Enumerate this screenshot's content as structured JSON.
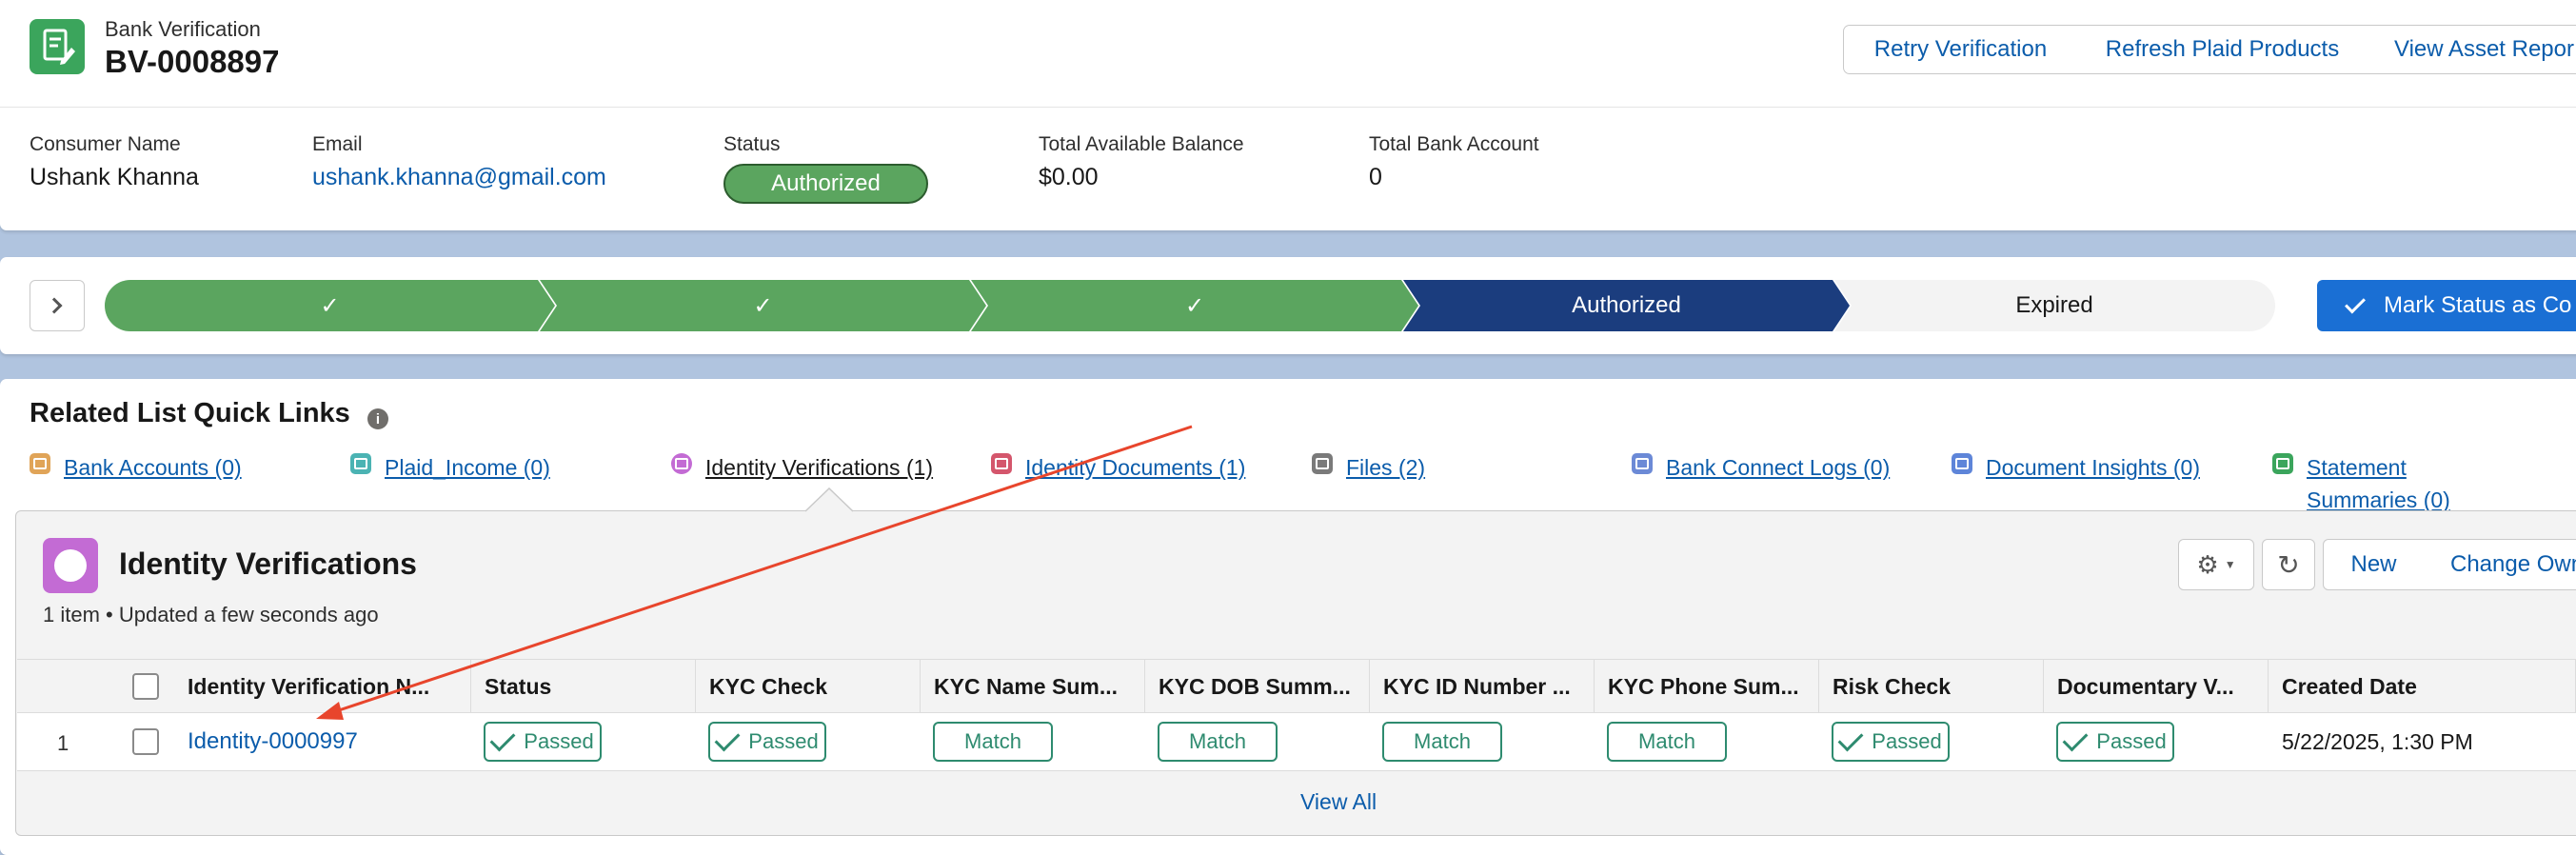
{
  "header": {
    "object_label": "Bank Verification",
    "record_name": "BV-0008897",
    "actions": [
      "Retry Verification",
      "Refresh Plaid Products",
      "View Asset Repor"
    ]
  },
  "highlights": [
    {
      "label": "Consumer Name",
      "value": "Ushank Khanna"
    },
    {
      "label": "Email",
      "value": "ushank.khanna@gmail.com"
    },
    {
      "label": "Status",
      "value": "Authorized"
    },
    {
      "label": "Total Available Balance",
      "value": "$0.00"
    },
    {
      "label": "Total Bank Account",
      "value": "0"
    }
  ],
  "path": {
    "stages": [
      "✓",
      "✓",
      "✓",
      "Authorized",
      "Expired"
    ],
    "mark_button": "Mark Status as Co"
  },
  "quick_links": {
    "title": "Related List Quick Links",
    "links": [
      {
        "label": "Bank Accounts (0)",
        "color": "#e0a458"
      },
      {
        "label": "Plaid_Income (0)",
        "color": "#4bb3b3"
      },
      {
        "label": "Identity Verifications (1)",
        "color": "#c36bd4"
      },
      {
        "label": "Identity Documents (1)",
        "color": "#d4566c"
      },
      {
        "label": "Files (2)",
        "color": "#7a7a7a"
      },
      {
        "label": "Bank Connect Logs (0)",
        "color": "#6c8ad6"
      },
      {
        "label": "Document Insights (0)",
        "color": "#5e85d9"
      },
      {
        "label": "Statement Summaries (0)",
        "color": "#3ba55c"
      }
    ]
  },
  "related_list": {
    "title": "Identity Verifications",
    "meta": "1 item • Updated a few seconds ago",
    "buttons": {
      "new": "New",
      "change_owner": "Change Own"
    },
    "columns": [
      "Identity Verification N...",
      "Status",
      "KYC Check",
      "KYC Name Sum...",
      "KYC DOB Summ...",
      "KYC ID Number ...",
      "KYC Phone Sum...",
      "Risk Check",
      "Documentary V...",
      "Created Date"
    ],
    "rows": [
      {
        "num": "1",
        "name": "Identity-0000997",
        "status": "Passed",
        "kyc_check": "Passed",
        "kyc_name": "Match",
        "kyc_dob": "Match",
        "kyc_id": "Match",
        "kyc_phone": "Match",
        "risk_check": "Passed",
        "documentary": "Passed",
        "created": "5/22/2025, 1:30 PM"
      }
    ],
    "view_all": "View All"
  },
  "colors": {
    "accent": "#0b5cab",
    "path_complete": "#5ba55f",
    "path_current": "#1b3d7e",
    "status_badge": "#5ba55f",
    "pill": "#2e8b6f",
    "annotation_arrow": "#e8452c"
  }
}
